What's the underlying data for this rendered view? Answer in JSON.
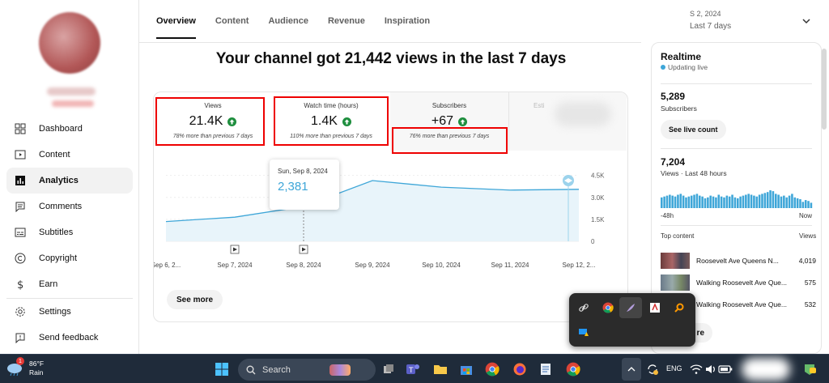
{
  "tabs": [
    "Overview",
    "Content",
    "Audience",
    "Revenue",
    "Inspiration"
  ],
  "date_range": {
    "line1": "S      2, 2024",
    "line2": "Last 7 days"
  },
  "headline": "Your channel got 21,442 views in the last 7 days",
  "metrics": [
    {
      "label": "Views",
      "value": "21.4K",
      "note": "78% more than previous 7 days"
    },
    {
      "label": "Watch time (hours)",
      "value": "1.4K",
      "note": "110% more than previous 7 days"
    },
    {
      "label": "Subscribers",
      "value": "+67",
      "note": "76% more than previous 7 days"
    },
    {
      "label": "Esti",
      "value": "",
      "note": ""
    }
  ],
  "chart_data": {
    "type": "area",
    "x": [
      "Sep 6, 2...",
      "Sep 7, 2024",
      "Sep 8, 2024",
      "Sep 9, 2024",
      "Sep 10, 2024",
      "Sep 11, 2024",
      "Sep 12, 2..."
    ],
    "values": [
      1350,
      1650,
      2381,
      4150,
      3700,
      3500,
      3550
    ],
    "y_ticks": [
      "4.5K",
      "3.0K",
      "1.5K",
      "0"
    ],
    "ylim": [
      0,
      5200
    ],
    "tooltip": {
      "date": "Sun, Sep 8, 2024",
      "value": "2,381"
    }
  },
  "see_more": "See more",
  "sidebar": {
    "items": [
      {
        "label": "Dashboard",
        "icon": "dashboard-icon"
      },
      {
        "label": "Content",
        "icon": "content-icon"
      },
      {
        "label": "Analytics",
        "icon": "analytics-icon"
      },
      {
        "label": "Comments",
        "icon": "comments-icon"
      },
      {
        "label": "Subtitles",
        "icon": "subtitles-icon"
      },
      {
        "label": "Copyright",
        "icon": "copyright-icon"
      },
      {
        "label": "Earn",
        "icon": "earn-icon"
      }
    ],
    "bottom": [
      {
        "label": "Settings",
        "icon": "gear-icon"
      },
      {
        "label": "Send feedback",
        "icon": "feedback-icon"
      }
    ]
  },
  "realtime": {
    "title": "Realtime",
    "status": "Updating live",
    "subs_value": "5,289",
    "subs_label": "Subscribers",
    "live_button": "See live count",
    "views_value": "7,204",
    "views_label": "Views · Last 48 hours",
    "axis_left": "-48h",
    "axis_right": "Now",
    "bar_values": [
      12,
      13,
      14,
      15,
      14,
      13,
      15,
      16,
      14,
      12,
      13,
      14,
      15,
      16,
      14,
      13,
      11,
      12,
      14,
      13,
      12,
      15,
      13,
      12,
      14,
      13,
      15,
      12,
      11,
      13,
      14,
      15,
      16,
      15,
      14,
      13,
      15,
      16,
      17,
      18,
      20,
      19,
      16,
      15,
      13,
      14,
      12,
      14,
      16,
      12,
      11,
      10,
      7,
      9,
      8,
      6
    ],
    "top_content_label": "Top content",
    "views_col": "Views",
    "top_content": [
      {
        "title": "Roosevelt Ave Queens N...",
        "views": "4,019"
      },
      {
        "title": "Walking Roosevelt Ave Que...",
        "views": "575"
      },
      {
        "title": "Walking Roosevelt Ave Que...",
        "views": "532"
      }
    ],
    "see_more_partial": "re"
  },
  "taskbar": {
    "temperature": "86°F",
    "weather": "Rain",
    "weather_badge": "1",
    "search_placeholder": "Search",
    "language": "ENG"
  },
  "colors": {
    "accent": "#3ea6d8",
    "highlight_box": "#e00000",
    "up_arrow": "#1e8e3e"
  }
}
